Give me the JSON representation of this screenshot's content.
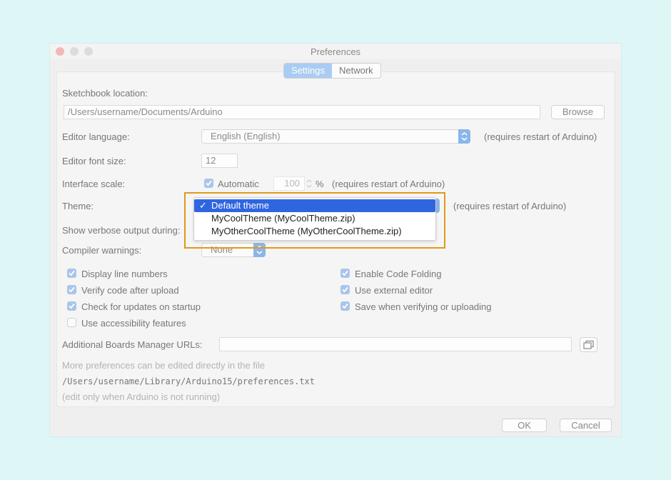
{
  "window": {
    "title": "Preferences"
  },
  "tabs": [
    {
      "label": "Settings",
      "active": true
    },
    {
      "label": "Network",
      "active": false
    }
  ],
  "settings": {
    "sketchbook_label": "Sketchbook location:",
    "sketchbook_value": "/Users/username/Documents/Arduino",
    "browse_label": "Browse",
    "editor_language_label": "Editor language:",
    "editor_language_value": "English (English)",
    "editor_language_note": "(requires restart of Arduino)",
    "font_size_label": "Editor font size:",
    "font_size_value": "12",
    "interface_scale_label": "Interface scale:",
    "automatic_label": "Automatic",
    "scale_value": "100",
    "scale_unit": "%",
    "scale_note": "(requires restart of Arduino)",
    "theme_label": "Theme:",
    "theme_note": "(requires restart of Arduino)",
    "verbose_label": "Show verbose output during:",
    "compiler_warnings_label": "Compiler warnings:",
    "compiler_warnings_value": "None",
    "checkboxes_left": [
      {
        "label": "Display line numbers",
        "checked": true
      },
      {
        "label": "Verify code after upload",
        "checked": true
      },
      {
        "label": "Check for updates on startup",
        "checked": true
      },
      {
        "label": "Use accessibility features",
        "checked": false
      }
    ],
    "checkboxes_right": [
      {
        "label": "Enable Code Folding",
        "checked": true
      },
      {
        "label": "Use external editor",
        "checked": true
      },
      {
        "label": "Save when verifying or uploading",
        "checked": true
      }
    ],
    "boards_urls_label": "Additional Boards Manager URLs:",
    "boards_urls_value": "",
    "more_prefs_note": "More preferences can be edited directly in the file",
    "prefs_path": "/Users/username/Library/Arduino15/preferences.txt",
    "edit_note": "(edit only when Arduino is not running)"
  },
  "theme_menu": {
    "items": [
      {
        "label": "Default theme",
        "selected": true
      },
      {
        "label": "MyCoolTheme  (MyCoolTheme.zip)",
        "selected": false
      },
      {
        "label": "MyOtherCoolTheme  (MyOtherCoolTheme.zip)",
        "selected": false
      }
    ]
  },
  "footer": {
    "ok_label": "OK",
    "cancel_label": "Cancel"
  },
  "colors": {
    "accent": "#2f66e0",
    "highlight_border": "#e09a1a",
    "background": "#dff6f6"
  }
}
